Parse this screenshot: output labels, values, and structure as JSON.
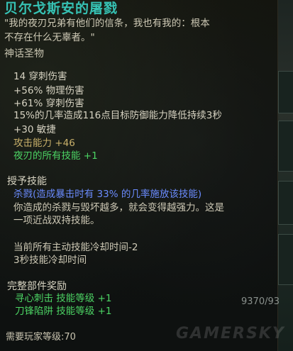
{
  "tooltip": {
    "item_name": "贝尔戈斯安的屠戮",
    "flavor_line1": "\"我的夜刃兄弟有他们的信条，我也有我的：根本",
    "flavor_line2": "不存在什么无辜者。\"",
    "rarity": "神话圣物",
    "mods": {
      "pierce_damage": "14 穿刺伤害",
      "physical_damage": "+56% 物理伤害",
      "pierce_damage_pct": "+61% 穿刺伤害",
      "proc_line": "15%的几率造成116点目标防御能力降低持续3秒",
      "agility": "+30 敏捷",
      "attack_power": "攻击能力 +46",
      "nightblade_skills": "夜刃的所有技能 +1"
    },
    "granted_skill_header": "授予技能",
    "granted_skill_name": "杀戮(造成暴击时有 33% 的几率施放该技能)",
    "granted_skill_desc1": "你造成的杀戮与毁坏越多，就会变得越强力。这是",
    "granted_skill_desc2": "一项近战双持技能。",
    "cooldown_line1": "当前所有主动技能冷却时间-2",
    "cooldown_line2": "3秒技能冷却时间",
    "set_bonus_header": "完整部件奖励",
    "set_bonus_1": "寻心刺击 技能等级 +1",
    "set_bonus_2": "刀锋陷阱 技能等级 +1",
    "requirement": "需要玩家等级:70"
  },
  "background": {
    "hp_text": "9370/93",
    "watermark": "GAMERSKY"
  }
}
